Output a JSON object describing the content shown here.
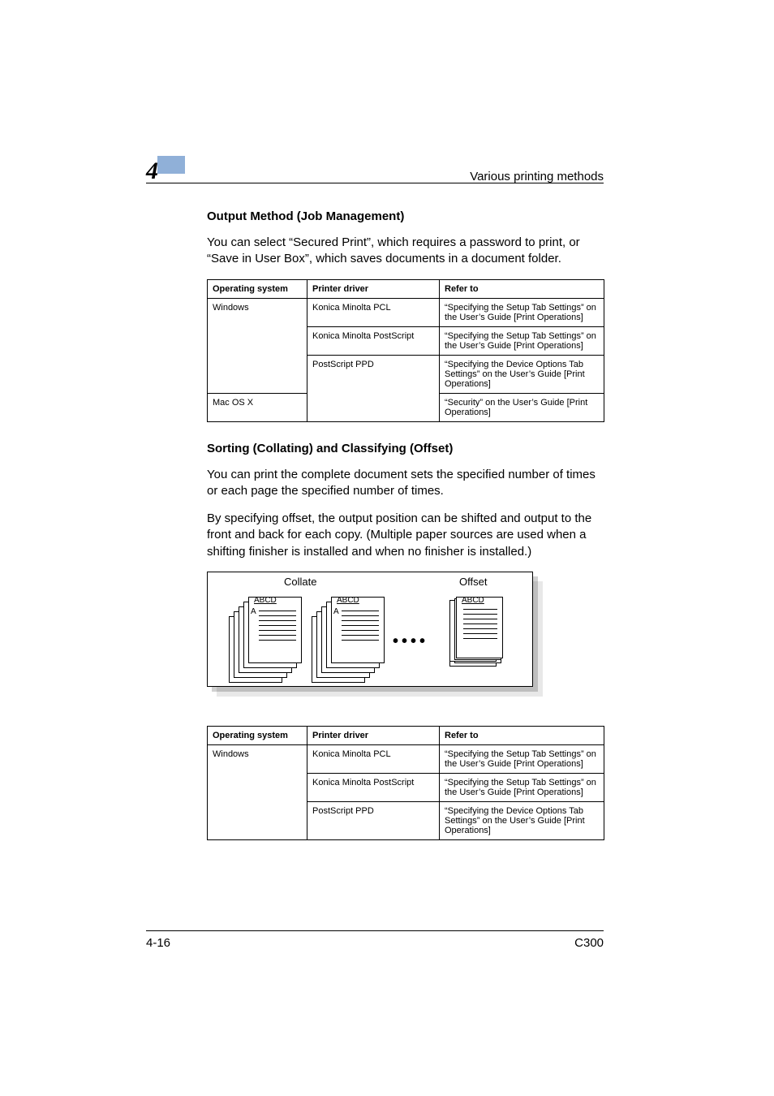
{
  "header": {
    "chapter_number": "4",
    "section_title": "Various printing methods"
  },
  "section1": {
    "heading": "Output Method (Job Management)",
    "paragraph": "You can select “Secured Print”, which requires a password to print, or “Save in User Box”, which saves documents in a document folder."
  },
  "table1": {
    "headers": {
      "os": "Operating system",
      "driver": "Printer driver",
      "refer": "Refer to"
    },
    "rows": [
      {
        "os": "Windows",
        "driver": "Konica Minolta PCL",
        "refer": "“Specifying the Setup Tab Settings” on the User’s Guide [Print Operations]"
      },
      {
        "os": "",
        "driver": "Konica Minolta PostScript",
        "refer": "“Specifying the Setup Tab Settings” on the User’s Guide [Print Operations]"
      },
      {
        "os": "",
        "driver": "PostScript PPD",
        "refer": "“Specifying the Device Options Tab Settings” on the User’s Guide [Print Operations]"
      },
      {
        "os": "Mac OS X",
        "driver": "",
        "refer": "“Security” on the User’s Guide [Print Operations]"
      }
    ]
  },
  "section2": {
    "heading": "Sorting (Collating) and Classifying (Offset)",
    "paragraph1": "You can print the complete document sets the specified number of times or each page the specified number of times.",
    "paragraph2": "By specifying offset, the output position can be shifted and output to the front and back for each copy. (Multiple paper sources are used when a shifting finisher is installed and when no finisher is installed.)"
  },
  "figure": {
    "label_collate": "Collate",
    "label_offset": "Offset",
    "doc_label": "ABCD",
    "side_label": "A"
  },
  "table2": {
    "headers": {
      "os": "Operating system",
      "driver": "Printer driver",
      "refer": "Refer to"
    },
    "rows": [
      {
        "os": "Windows",
        "driver": "Konica Minolta PCL",
        "refer": "“Specifying the Setup Tab Settings” on the User’s Guide [Print Operations]"
      },
      {
        "os": "",
        "driver": "Konica Minolta PostScript",
        "refer": "“Specifying the Setup Tab Settings” on the User’s Guide [Print Operations]"
      },
      {
        "os": "",
        "driver": "PostScript PPD",
        "refer": "“Specifying the Device Options Tab Settings” on the User’s Guide [Print Operations]"
      }
    ]
  },
  "footer": {
    "page": "4-16",
    "model": "C300"
  }
}
